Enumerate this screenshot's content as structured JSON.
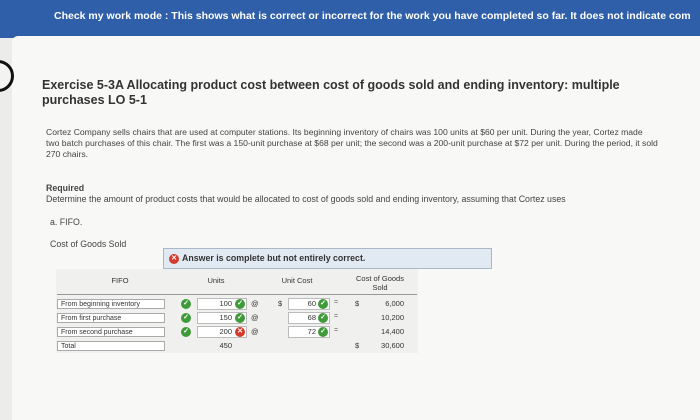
{
  "banner": {
    "text": "Check my work mode : This shows what is correct or incorrect for the work you have completed so far. It does not indicate com"
  },
  "exercise": {
    "title": "Exercise 5-3A Allocating product cost between cost of goods sold and ending inventory: multiple purchases LO 5-1",
    "paragraph": "Cortez Company sells chairs that are used at computer stations. Its beginning inventory of chairs was 100 units at $60 per unit. During the year, Cortez made two batch purchases of this chair. The first was a 150-unit purchase at $68 per unit; the second was a 200-unit purchase at $72 per unit. During the period, it sold 270 chairs.",
    "required_heading": "Required",
    "required_text": "Determine the amount of product costs that would be allocated to cost of goods sold and ending inventory, assuming that Cortez uses",
    "part": "a. FIFO.",
    "section_label": "Cost of Goods Sold"
  },
  "answer_status": "Answer is complete but not entirely correct.",
  "table": {
    "headers": {
      "label": "FIFO",
      "units": "Units",
      "unit_cost": "Unit Cost",
      "cogs": "Cost of Goods Sold"
    },
    "rows": [
      {
        "label": "From beginning inventory",
        "units": "100",
        "unit_cost": "60",
        "cogs": "6,000",
        "units_status": "correct"
      },
      {
        "label": "From first purchase",
        "units": "150",
        "unit_cost": "68",
        "cogs": "10,200",
        "units_status": "correct"
      },
      {
        "label": "From second purchase",
        "units": "200",
        "unit_cost": "72",
        "cogs": "14,400",
        "units_status": "incorrect"
      },
      {
        "label": "Total",
        "units": "450",
        "unit_cost": "",
        "cogs": "30,600"
      }
    ],
    "symbols": {
      "at": "@",
      "equals": "=",
      "dollar": "$"
    }
  },
  "colors": {
    "banner": "#2f5fa8",
    "correct": "#3f9a3a",
    "incorrect": "#d33b2c",
    "answer_banner": "#e1e9f2"
  }
}
